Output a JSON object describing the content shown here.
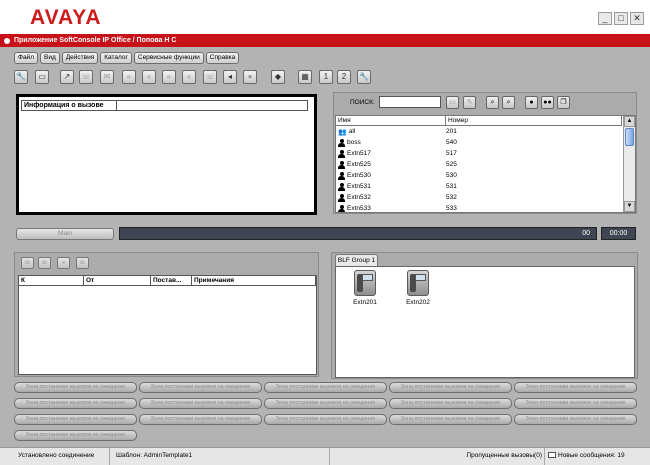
{
  "header": {
    "logo": "AVAYA",
    "title": "Приложение SoftConsole IP Office / Попова Н С",
    "window_controls": [
      "_",
      "□",
      "✕"
    ]
  },
  "menu": [
    "Файл",
    "Вид",
    "Действия",
    "Каталог",
    "Сервисные функции",
    "Справка"
  ],
  "toolbar_icons": [
    "wrench-icon",
    "save-icon",
    "transfer-icon",
    "answer-icon",
    "hold-icon",
    "conference-icon",
    "park-icon",
    "retrieve-icon",
    "forward-icon",
    "volume-icon",
    "record-icon",
    "updown-icon",
    "dialpad-icon",
    "directory-icon",
    "notes-icon",
    "tools-icon"
  ],
  "call_info": {
    "column": "Информация о вызове"
  },
  "directory": {
    "search_label": "ПОИСК:",
    "search_value": "",
    "columns": [
      "Имя",
      "Номер"
    ],
    "rows": [
      {
        "name": "all",
        "number": "201",
        "icon": "group-icon"
      },
      {
        "name": "boss",
        "number": "540",
        "icon": "user-icon"
      },
      {
        "name": "Extn517",
        "number": "517",
        "icon": "user-icon"
      },
      {
        "name": "Extn525",
        "number": "525",
        "icon": "user-icon"
      },
      {
        "name": "Extn530",
        "number": "530",
        "icon": "user-icon"
      },
      {
        "name": "Extn531",
        "number": "531",
        "icon": "user-icon"
      },
      {
        "name": "Extn532",
        "number": "532",
        "icon": "user-icon"
      },
      {
        "name": "Extn533",
        "number": "533",
        "icon": "user-icon"
      }
    ]
  },
  "status_row": {
    "main_button": "Main",
    "count": "00",
    "timer": "00:00"
  },
  "queue": {
    "columns": [
      "К",
      "От",
      "Постав...",
      "Примечания"
    ]
  },
  "blf": {
    "tab": "BLF Group 1",
    "items": [
      {
        "label": "Extn201"
      },
      {
        "label": "Extn202"
      }
    ]
  },
  "park_slots": {
    "label": "Зона постановки вызовов на ожидание",
    "count": 16
  },
  "statusbar": {
    "connection": "Установлено соединение",
    "template": "Шаблон: AdminTemplate1",
    "missed": "Пропущенные вызовы(0)",
    "messages": "Новые сообщения: 19"
  }
}
